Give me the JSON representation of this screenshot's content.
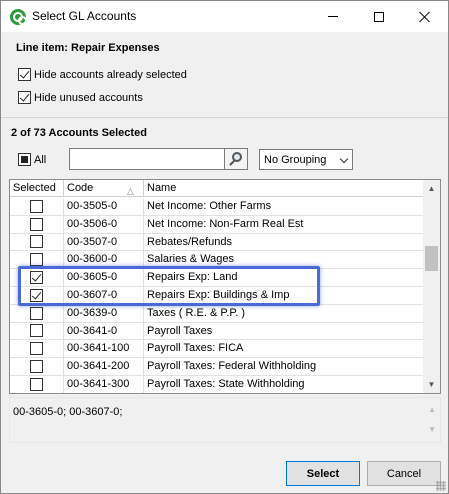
{
  "window": {
    "title": "Select GL Accounts"
  },
  "header": {
    "line_item": "Line item: Repair Expenses",
    "hide_selected": {
      "label": "Hide accounts already selected",
      "checked": true
    },
    "hide_unused": {
      "label": "Hide unused accounts",
      "checked": true
    }
  },
  "summary": "2 of 73 Accounts Selected",
  "toolbar": {
    "all_label": "All",
    "search_value": "",
    "grouping_value": "No Grouping"
  },
  "grid": {
    "columns": [
      "Selected",
      "Code",
      "Name"
    ],
    "rows": [
      {
        "selected": false,
        "code": "00-3505-0",
        "name": "Net Income: Other Farms"
      },
      {
        "selected": false,
        "code": "00-3506-0",
        "name": "Net Income: Non-Farm Real Est"
      },
      {
        "selected": false,
        "code": "00-3507-0",
        "name": "Rebates/Refunds"
      },
      {
        "selected": false,
        "code": "00-3600-0",
        "name": "Salaries & Wages"
      },
      {
        "selected": true,
        "code": "00-3605-0",
        "name": "Repairs Exp: Land"
      },
      {
        "selected": true,
        "code": "00-3607-0",
        "name": "Repairs Exp: Buildings & Imp"
      },
      {
        "selected": false,
        "code": "00-3639-0",
        "name": "Taxes ( R.E. & P.P. )"
      },
      {
        "selected": false,
        "code": "00-3641-0",
        "name": "Payroll Taxes"
      },
      {
        "selected": false,
        "code": "00-3641-100",
        "name": "Payroll Taxes: FICA"
      },
      {
        "selected": false,
        "code": "00-3641-200",
        "name": "Payroll Taxes: Federal Withholding"
      },
      {
        "selected": false,
        "code": "00-3641-300",
        "name": "Payroll Taxes: State Withholding"
      }
    ]
  },
  "selection_text": "00-3605-0; 00-3607-0;",
  "buttons": {
    "select": "Select",
    "cancel": "Cancel"
  },
  "colors": {
    "highlight": "#4a6bd6",
    "default_button_border": "#0078d7"
  }
}
